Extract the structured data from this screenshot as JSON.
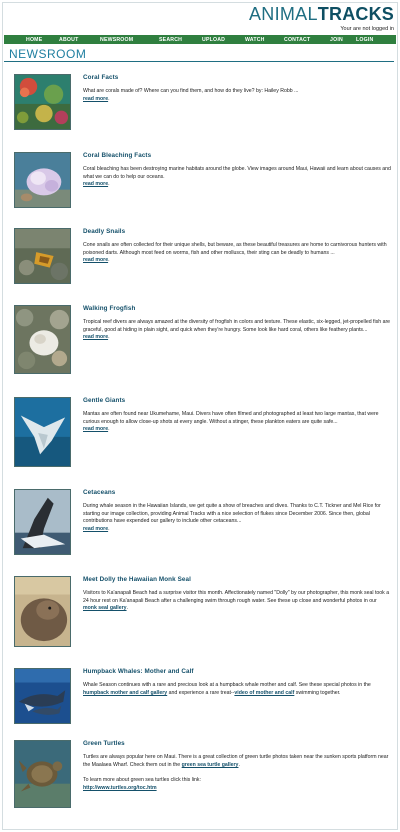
{
  "header": {
    "logo_part1": "ANIMAL",
    "logo_part2": "TRACKS",
    "login_status": "Your are not logged in"
  },
  "nav": {
    "items": [
      "HOME",
      "ABOUT",
      "NEWSROOM",
      "SEARCH",
      "UPLOAD",
      "WATCH",
      "CONTACT",
      "JOIN",
      "LOGIN"
    ]
  },
  "page": {
    "title": "NEWSROOM"
  },
  "articles": [
    {
      "title": "Coral Facts",
      "body": "What are corals made of? Where can you find them, and how do they live? by: Hailey Robb ...",
      "link": "read more"
    },
    {
      "title": "Coral Bleaching Facts",
      "body": "Coral bleaching has been destroying marine habitats around the globe. View images around Maui, Hawaii and learn about causes and what we can do to help our oceans.",
      "link": "read more"
    },
    {
      "title": "Deadly Snails",
      "body": "Cone snails are often collected for their unique shells, but beware, as these beautiful treasures are home to carnivorous hunters with poisoned darts. Although most feed on worms, fish and other molluscs, their sting can be deadly to humans ...",
      "link": "read more"
    },
    {
      "title": "Walking Frogfish",
      "body": "Tropical reef divers are always amazed at the diversity of frogfish in colors and texture. These elastic, six-legged, jet-propelled fish are graceful, good at hiding in plain sight, and quick when they're hungry. Some look like hard coral, others like feathery plants...",
      "link": "read more"
    },
    {
      "title": "Gentle Giants",
      "body": "Mantas are often found near Ukumehame, Maui. Divers have often filmed and photographed at least two large mantas, that were curious enough to allow close-up shots at every angle. Without a stinger, these plankton eaters are quite safe...",
      "link": "read more"
    },
    {
      "title": "Cetaceans",
      "body": "During whale season in the Hawaiian Islands, we get quite a show of breaches and dives. Thanks to C.T. Tickner and Mel Rice for starting our image collection, providing Animal Tracks with a nice selection of flukes since December 2006. Since then, global contributions have expended our gallery to include other cetaceans...",
      "link": "read more"
    },
    {
      "title": "Meet Dolly the Hawaiian Monk Seal",
      "body": "Visitors to Ka'anapali Beach had a surprise visitor this month. Affectionately named \"Dolly\" by our photographer, this monk seal took a 24 hour rest on Ka'anapali Beach after a challenging swim through rough water. See these up close and wonderful photos in our",
      "link": "monk seal gallery",
      "body_after": "."
    },
    {
      "title": "Humpback Whales: Mother and Calf",
      "body": "Whale Season continues with a rare and precious look at a humpback whale mother and calf. See these special photos in the",
      "link": "humpback mother and calf gallery",
      "body_mid": "and experience a rare treat--",
      "link2": "video of mother and calf",
      "body_after": "swimming together."
    },
    {
      "title": "Green Turtles",
      "body": "Turtles are always popular here on Maui. There is a great collection of green turtle photos taken near the sunken sports platform near the Maalaea Wharf. Check them out in the",
      "link": "green sea turtle gallery",
      "body_after": ".",
      "extra_text": "To learn more about green sea turtles click this link:",
      "extra_link": "http://www.turtles.org/toc.htm"
    }
  ],
  "colors": {
    "nav_bg": "#2f7f3f",
    "title_blue": "#1f7fa0",
    "link_dark": "#14506a",
    "logo_dark": "#0e4f63"
  }
}
